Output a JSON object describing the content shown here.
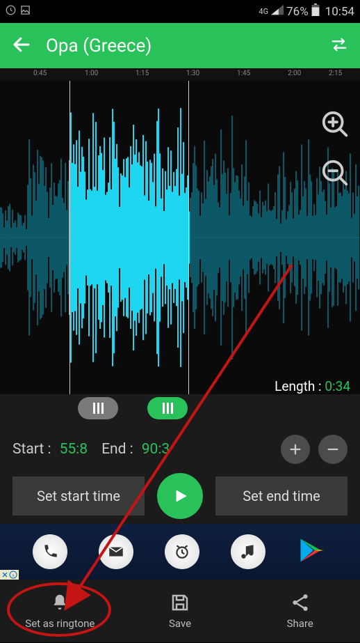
{
  "status": {
    "network": "4G",
    "battery": "76%",
    "time": "10:54"
  },
  "header": {
    "title": "Opa (Greece)"
  },
  "timeline": {
    "ticks": [
      "0:45",
      "1:00",
      "1:15",
      "1:30",
      "1:45",
      "2:00",
      "2:15"
    ]
  },
  "length": {
    "label": "Length :",
    "value": "0:34"
  },
  "times": {
    "start_label": "Start :",
    "start_value": "55:8",
    "end_label": "End :",
    "end_value": "90:3"
  },
  "buttons": {
    "set_start": "Set start time",
    "set_end": "Set end time"
  },
  "nav": {
    "ringtone": "Set as ringtone",
    "save": "Save",
    "share": "Share"
  }
}
